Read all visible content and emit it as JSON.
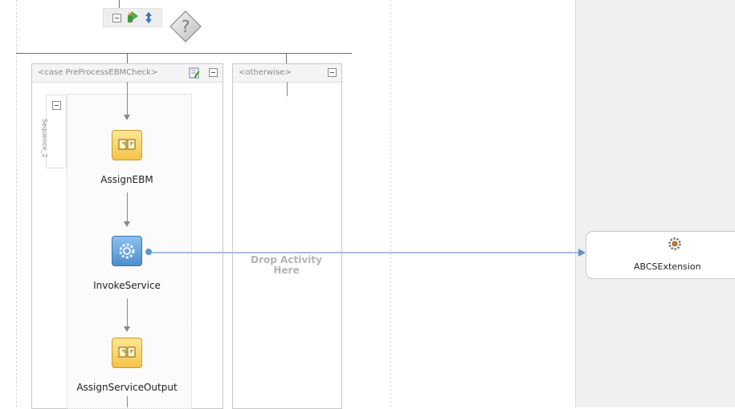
{
  "toolbar": {
    "icons": [
      "collapse-icon",
      "add-case-icon",
      "sort-icon"
    ]
  },
  "switch": {
    "icon": "switch-diamond-icon",
    "symbol": "?"
  },
  "branches": {
    "case": {
      "label": "<case PreProcessEBMCheck>"
    },
    "otherwise": {
      "label": "<otherwise>"
    }
  },
  "sequence": {
    "label": "Sequence_2"
  },
  "activities": {
    "assign_ebm": {
      "label": "AssignEBM",
      "icon": "assign-icon"
    },
    "invoke_service": {
      "label": "InvokeService",
      "icon": "invoke-icon"
    },
    "assign_output": {
      "label": "AssignServiceOutput",
      "icon": "assign-icon"
    }
  },
  "drop_zone": {
    "line1": "Drop Activity",
    "line2": "Here"
  },
  "partner_link": {
    "label": "ABCSExtension",
    "icon": "gear-service-icon"
  },
  "colors": {
    "assign_fill": "#f4c44a",
    "invoke_fill": "#4d8fcf",
    "connector": "#9fb4d8",
    "partner_lane": "#f0f0f0"
  }
}
